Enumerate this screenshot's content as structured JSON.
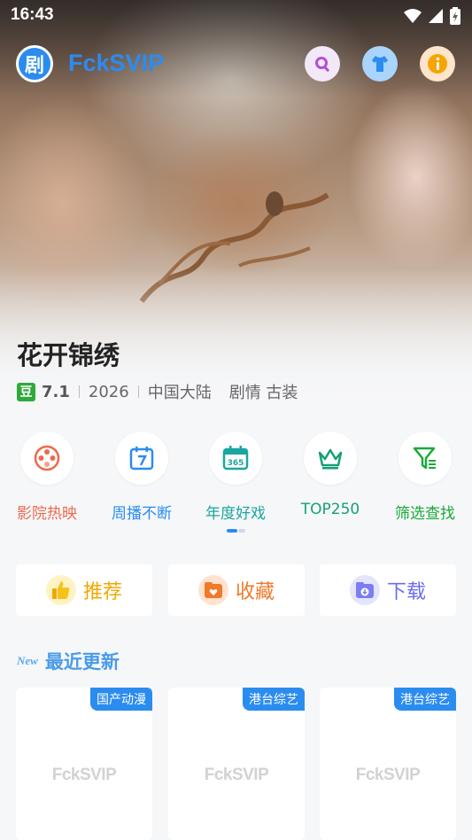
{
  "status_bar": {
    "time": "16:43"
  },
  "app": {
    "logo_text": "剧",
    "title": "FckSVIP"
  },
  "hero": {
    "title": "花开锦绣",
    "douban_icon": "豆",
    "rating": "7.1",
    "year": "2026",
    "region": "中国大陆",
    "genres": "剧情 古装"
  },
  "categories": [
    {
      "label": "影院热映",
      "icon": "film-reel-icon",
      "color": "#ec6a4e"
    },
    {
      "label": "周播不断",
      "icon": "calendar-7-icon",
      "color": "#2b8cf0"
    },
    {
      "label": "年度好戏",
      "icon": "calendar-365-icon",
      "color": "#1aa6a0"
    },
    {
      "label": "TOP250",
      "icon": "crown-icon",
      "color": "#16a077"
    },
    {
      "label": "筛选查找",
      "icon": "filter-icon",
      "color": "#1aaa3a"
    }
  ],
  "actions": [
    {
      "label": "推荐",
      "icon": "thumbs-up-icon",
      "color": "#f0a800"
    },
    {
      "label": "收藏",
      "icon": "favorite-folder-icon",
      "color": "#f07a2a"
    },
    {
      "label": "下载",
      "icon": "download-folder-icon",
      "color": "#6a6cf0"
    }
  ],
  "recent": {
    "badge": "New",
    "title": "最近更新",
    "items": [
      {
        "tag": "国产动漫",
        "placeholder": "FckSVIP"
      },
      {
        "tag": "港台综艺",
        "placeholder": "FckSVIP"
      },
      {
        "tag": "港台综艺",
        "placeholder": "FckSVIP"
      }
    ]
  },
  "colors": {
    "accent": "#2b8cf0"
  }
}
